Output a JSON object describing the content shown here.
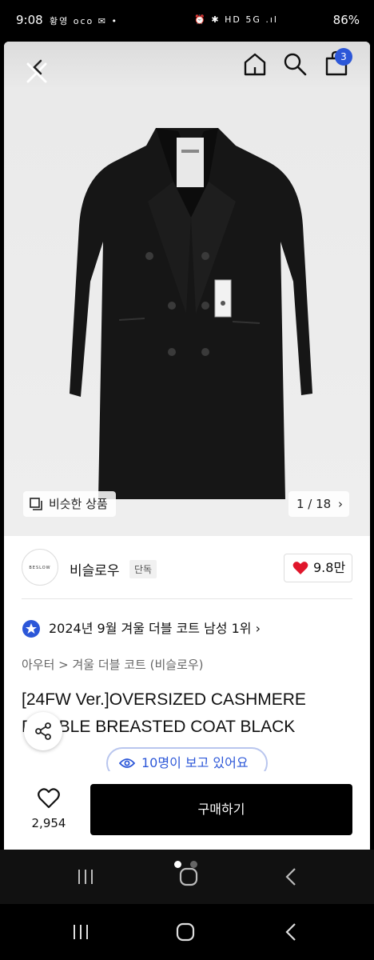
{
  "status_bar": {
    "time": "9:08",
    "notifications": "황영 oco ✉ •",
    "system": "⏰ ✱ HD 5G .ıl",
    "battery": "86%"
  },
  "top_nav": {
    "cart_count": "3"
  },
  "gallery": {
    "similar_label": "비슷한 상품",
    "counter": "1 / 18"
  },
  "brand": {
    "logo_text": "BESLOW",
    "name": "비슬로우",
    "tag": "단독",
    "likes": "9.8만"
  },
  "rank": {
    "text": "2024년 9월 겨울 더블 코트 남성 1위"
  },
  "breadcrumb": "아우터 > 겨울 더블 코트 (비슬로우)",
  "product": {
    "title": "[24FW Ver.]OVERSIZED CASHMERE DOUBLE BREASTED COAT BLACK"
  },
  "viewers": "10명이 보고 있어요",
  "bottom": {
    "wish_count": "2,954",
    "buy_label": "구매하기"
  },
  "colors": {
    "accent": "#2c57d8",
    "like_heart": "#e0162b"
  },
  "icons": [
    "close-icon",
    "home-icon",
    "search-icon",
    "shopping-bag-icon",
    "similar-items-icon",
    "chevron-right-icon",
    "heart-icon",
    "rank-badge-icon",
    "share-icon",
    "eye-icon",
    "recent-apps-icon",
    "home-button-icon",
    "back-icon"
  ]
}
